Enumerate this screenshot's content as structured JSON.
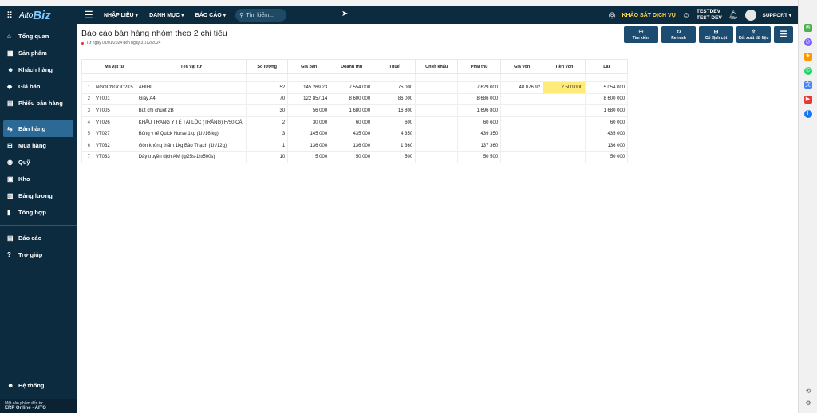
{
  "topbar": {
    "brand_prefix": "Aito",
    "brand": "Biz",
    "menu": [
      "NHẬP LIỆU ▾",
      "DANH MỤC ▾",
      "BÁO CÁO ▾"
    ],
    "search_placeholder": "Tìm kiếm...",
    "survey": "KHẢO SÁT DỊCH VỤ",
    "user_name": "TESTDEV",
    "user_sub": "TEST DEV",
    "support": "SUPPORT ▾"
  },
  "sidebar": {
    "items": [
      {
        "label": "Tổng quan",
        "icon": "home-icon",
        "glyph": "⌂"
      },
      {
        "label": "Sản phẩm",
        "icon": "product-icon",
        "glyph": "▦"
      },
      {
        "label": "Khách hàng",
        "icon": "customers-icon",
        "glyph": "☻"
      },
      {
        "label": "Giá bán",
        "icon": "price-tag-icon",
        "glyph": "◆"
      },
      {
        "label": "Phiếu bán hàng",
        "icon": "receipt-icon",
        "glyph": "▤"
      },
      {
        "label": "Bán hàng",
        "icon": "sales-icon",
        "glyph": "⇆"
      },
      {
        "label": "Mua hàng",
        "icon": "cart-icon",
        "glyph": "⊞"
      },
      {
        "label": "Quỹ",
        "icon": "fund-icon",
        "glyph": "◉"
      },
      {
        "label": "Kho",
        "icon": "warehouse-icon",
        "glyph": "▣"
      },
      {
        "label": "Bảng lương",
        "icon": "payroll-icon",
        "glyph": "▥"
      },
      {
        "label": "Tổng hợp",
        "icon": "summary-icon",
        "glyph": "▮"
      },
      {
        "label": "Báo cáo",
        "icon": "report-icon",
        "glyph": "▤"
      },
      {
        "label": "Trợ giúp",
        "icon": "help-icon",
        "glyph": "?"
      }
    ],
    "settings_label": "Hệ thống",
    "footer_line1": "Một sản phẩm đến từ",
    "footer_line2": "ERP Online - AITO"
  },
  "page": {
    "title": "Báo cáo bán hàng nhóm theo 2 chỉ tiêu",
    "date_range": "Từ ngày 01/01/2024 đến ngày 31/12/2024"
  },
  "actions": [
    {
      "label": "Tìm kiếm",
      "icon": "binoculars-icon",
      "glyph": "⚇"
    },
    {
      "label": "Refresh",
      "icon": "refresh-icon",
      "glyph": "↻"
    },
    {
      "label": "Cố định cột",
      "icon": "pin-column-icon",
      "glyph": "⊞"
    },
    {
      "label": "Kết xuất dữ liệu",
      "icon": "export-icon",
      "glyph": "⇪"
    }
  ],
  "table": {
    "headers": [
      "Mã vật tư",
      "Tên vật tư",
      "Số lượng",
      "Giá bán",
      "Doanh thu",
      "Thuế",
      "Chiết khấu",
      "Phải thu",
      "Giá vốn",
      "Tiền vốn",
      "Lãi"
    ],
    "rows": [
      [
        "1",
        "NGOCNGOC2K5",
        "AHIHI",
        "52",
        "145 269.23",
        "7 554 000",
        "75 000",
        "",
        "7 629 000",
        "48 076.92",
        "2 500 000",
        "5 054 000"
      ],
      [
        "2",
        "VT001",
        "Giấy A4",
        "70",
        "122 857.14",
        "8 600 000",
        "86 000",
        "",
        "8 686 000",
        "",
        "",
        "8 600 000"
      ],
      [
        "3",
        "VT005",
        "Bút chì chuốt 2B",
        "30",
        "56 000",
        "1 680 000",
        "16 800",
        "",
        "1 696 800",
        "",
        "",
        "1 680 000"
      ],
      [
        "4",
        "VT026",
        "KHẨU TRANG Y TẾ TÀI LỘC (TRẮNG) H/50 CÁI",
        "2",
        "30 000",
        "60 000",
        "600",
        "",
        "60 600",
        "",
        "",
        "60 000"
      ],
      [
        "5",
        "VT027",
        "Bông y tế Quick Nurse 1kg (1h/16 kg)",
        "3",
        "145 000",
        "435 000",
        "4 350",
        "",
        "439 350",
        "",
        "",
        "435 000"
      ],
      [
        "6",
        "VT032",
        "Gòn không thấm 1kg Bảo Thạch (1h/12g)",
        "1",
        "136 000",
        "136 000",
        "1 360",
        "",
        "137 360",
        "",
        "",
        "136 000"
      ],
      [
        "7",
        "VT033",
        "Dây truyền dịch AM (g/25s-1h/500s)",
        "10",
        "5 000",
        "50 000",
        "500",
        "",
        "50 500",
        "",
        "",
        "50 000"
      ]
    ]
  }
}
